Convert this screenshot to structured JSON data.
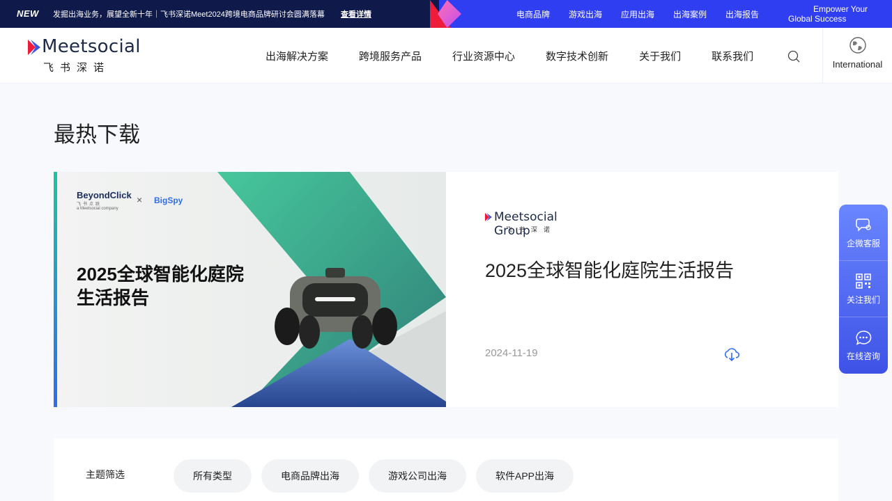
{
  "topbar": {
    "badge": "NEW",
    "notice": "发掘出海业务，展望全新十年｜飞书深诺Meet2024跨境电商品牌研讨会圆满落幕",
    "notice_link": "查看详情",
    "links": [
      "电商品牌",
      "游戏出海",
      "应用出海",
      "出海案例",
      "出海报告"
    ],
    "slogan_line1": "Empower Your",
    "slogan_line2": "Global Success",
    "colors": {
      "dark": "#0f1a4a",
      "brand": "#2f3ef0"
    }
  },
  "header": {
    "logo_word": "Meetsocial",
    "logo_cn": "飞书深诺",
    "nav": [
      "出海解决方案",
      "跨境服务产品",
      "行业资源中心",
      "数字技术创新",
      "关于我们",
      "联系我们"
    ],
    "search_icon": "search-icon",
    "international_label": "International",
    "globe_icon": "globe-icon"
  },
  "main": {
    "title": "最热下载",
    "featured": {
      "cover": {
        "brand1": "BeyondClick",
        "brand1_cn": "飞书点跃",
        "brand1_sub": "a Meetsocial company",
        "separator": "×",
        "brand2": "BigSpy",
        "title_line1": "2025全球智能化庭院",
        "title_line2": "生活报告"
      },
      "group_logo_word": "Meetsocial Group",
      "group_logo_cn": "飞书深诺",
      "title": "2025全球智能化庭院生活报告",
      "date": "2024-11-19",
      "download_icon": "cloud-download-icon"
    },
    "filter": {
      "label": "主题筛选",
      "chips": [
        "所有类型",
        "电商品牌出海",
        "游戏公司出海",
        "软件APP出海"
      ]
    }
  },
  "side_panel": {
    "items": [
      {
        "label": "企微客服",
        "icon": "chat-service-icon"
      },
      {
        "label": "关注我们",
        "icon": "qr-code-icon"
      },
      {
        "label": "在线咨询",
        "icon": "message-icon"
      }
    ]
  }
}
